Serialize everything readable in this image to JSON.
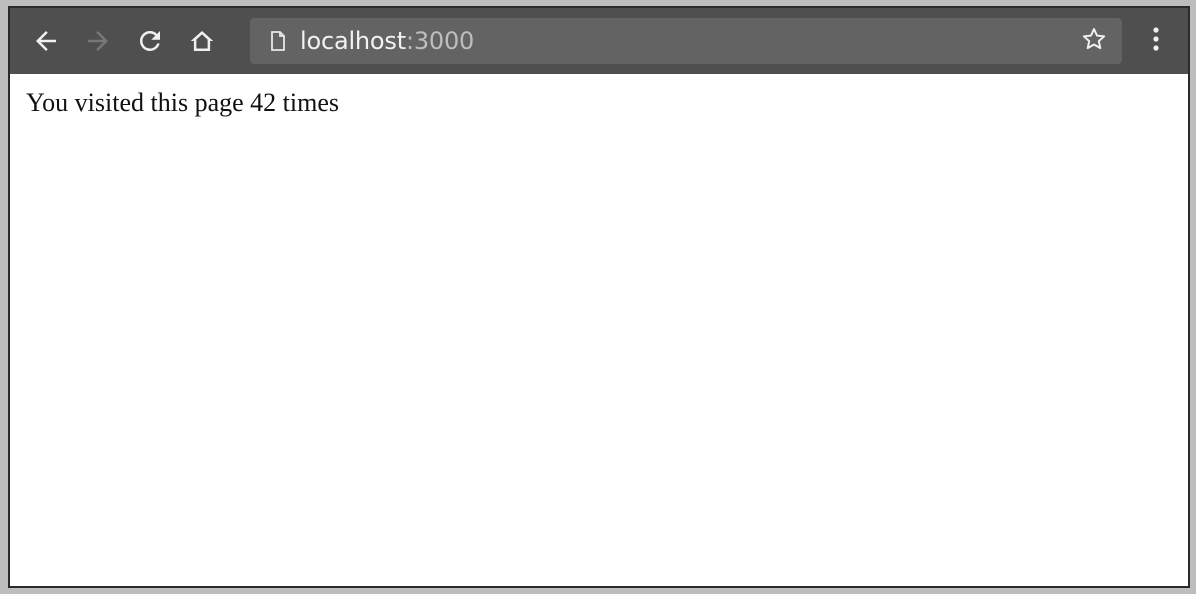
{
  "browser": {
    "toolbar_color": "#4f4f4f",
    "omnibox_color": "#636363",
    "icons": {
      "back": "back-arrow-icon",
      "forward": "forward-arrow-icon",
      "reload": "reload-icon",
      "home": "home-icon",
      "page": "page-icon",
      "bookmark": "star-icon",
      "menu": "kebab-menu-icon"
    },
    "address": {
      "host": "localhost",
      "port": ":3000"
    }
  },
  "page": {
    "message": "You visited this page 42 times"
  }
}
